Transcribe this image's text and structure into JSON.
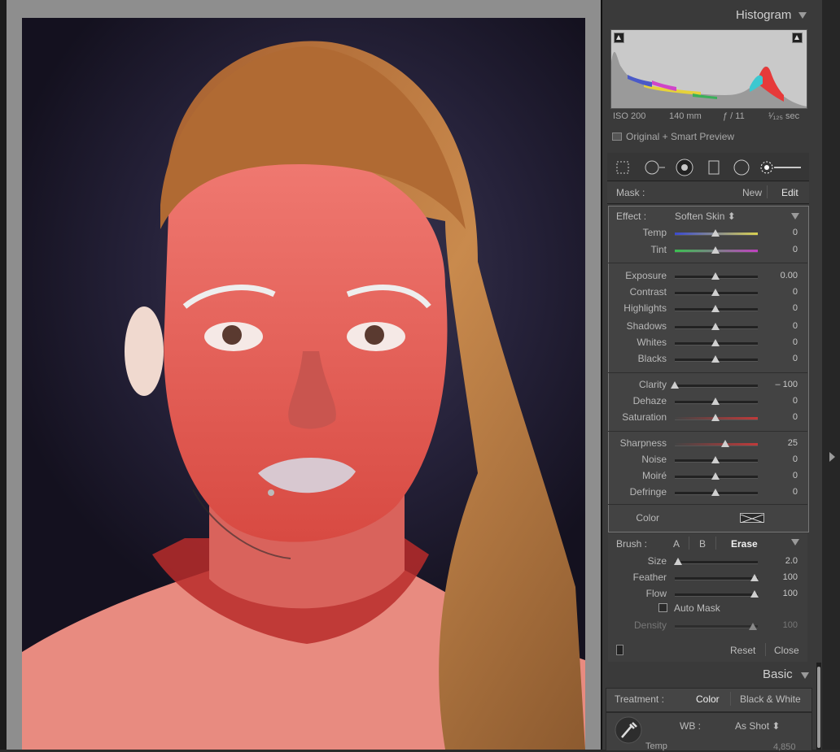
{
  "histogram": {
    "title": "Histogram",
    "iso": "ISO 200",
    "focal": "140 mm",
    "aperture": "ƒ / 11",
    "shutter": "¹⁄₁₂₅ sec",
    "preview_label": "Original + Smart Preview"
  },
  "mask": {
    "label": "Mask :",
    "new": "New",
    "edit": "Edit"
  },
  "effect": {
    "label": "Effect :",
    "preset": "Soften Skin ⬍",
    "rows": [
      {
        "label": "Temp",
        "value": "0",
        "pos": 0.5
      },
      {
        "label": "Tint",
        "value": "0",
        "pos": 0.5
      },
      {
        "label": "Exposure",
        "value": "0.00",
        "pos": 0.5
      },
      {
        "label": "Contrast",
        "value": "0",
        "pos": 0.5
      },
      {
        "label": "Highlights",
        "value": "0",
        "pos": 0.5
      },
      {
        "label": "Shadows",
        "value": "0",
        "pos": 0.5
      },
      {
        "label": "Whites",
        "value": "0",
        "pos": 0.5
      },
      {
        "label": "Blacks",
        "value": "0",
        "pos": 0.5
      },
      {
        "label": "Clarity",
        "value": "– 100",
        "pos": 0.0
      },
      {
        "label": "Dehaze",
        "value": "0",
        "pos": 0.5
      },
      {
        "label": "Saturation",
        "value": "0",
        "pos": 0.5
      },
      {
        "label": "Sharpness",
        "value": "25",
        "pos": 0.62
      },
      {
        "label": "Noise",
        "value": "0",
        "pos": 0.5
      },
      {
        "label": "Moiré",
        "value": "0",
        "pos": 0.5
      },
      {
        "label": "Defringe",
        "value": "0",
        "pos": 0.5
      }
    ],
    "color_label": "Color"
  },
  "brush": {
    "label": "Brush :",
    "a": "A",
    "b": "B",
    "erase": "Erase",
    "rows": [
      {
        "label": "Size",
        "value": "2.0",
        "pos": 0.02
      },
      {
        "label": "Feather",
        "value": "100",
        "pos": 1.0
      },
      {
        "label": "Flow",
        "value": "100",
        "pos": 1.0
      }
    ],
    "auto_mask": "Auto Mask",
    "density_label": "Density",
    "density_value": "100",
    "reset": "Reset",
    "close": "Close"
  },
  "basic": {
    "title": "Basic",
    "treatment_label": "Treatment :",
    "color": "Color",
    "bw": "Black & White",
    "wb_label": "WB :",
    "wb_value": "As Shot ⬍",
    "temp_label": "Temp",
    "temp_value": "4,850"
  },
  "colors": {
    "mask_overlay": "#e03c3c",
    "panel_bg": "#3a3a3a",
    "effect_bg": "#434343"
  }
}
